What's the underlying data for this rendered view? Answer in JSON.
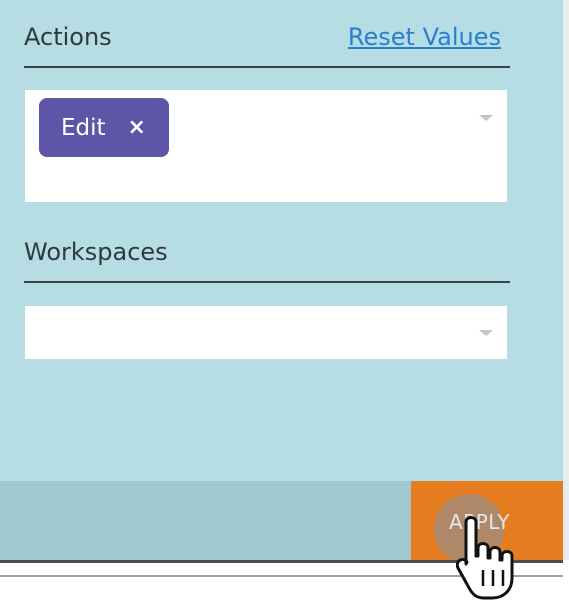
{
  "filters": {
    "actions": {
      "label": "Actions",
      "reset_label": "Reset Values",
      "selected_tags": [
        {
          "label": "Edit",
          "remove_glyph": "×"
        }
      ],
      "dropdown_icon": "chevron-down-icon"
    },
    "workspaces": {
      "label": "Workspaces",
      "value": "",
      "dropdown_icon": "chevron-down-icon"
    }
  },
  "footer": {
    "apply_label": "APPLY"
  },
  "colors": {
    "panel_bg": "#b5dde3",
    "tag_bg": "#5d55a7",
    "apply_bg": "#e57c20",
    "link": "#2b7fd0"
  },
  "cursor": {
    "icon": "hand-pointer-icon"
  }
}
